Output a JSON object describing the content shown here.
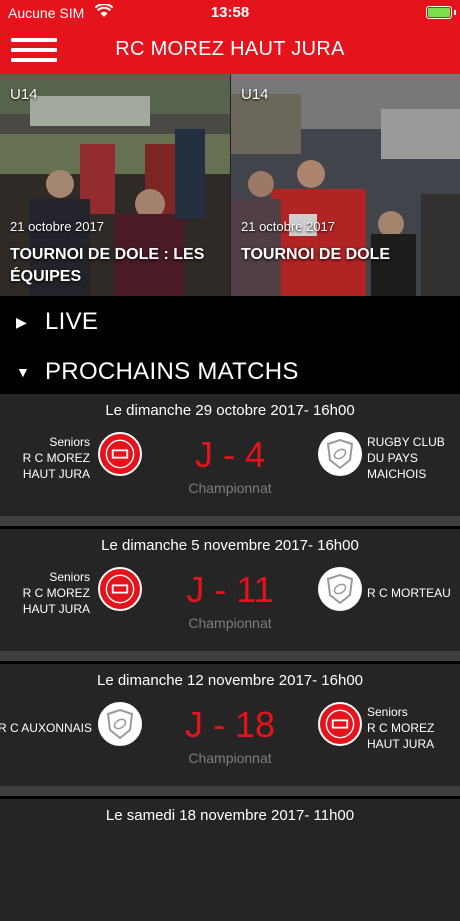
{
  "status_bar": {
    "carrier": "Aucune SIM",
    "time": "13:58"
  },
  "header": {
    "title": "RC MOREZ HAUT JURA"
  },
  "news": [
    {
      "category": "U14",
      "date": "21 octobre 2017",
      "title": "TOURNOI DE DOLE : LES ÉQUIPES"
    },
    {
      "category": "U14",
      "date": "21 octobre 2017",
      "title": "TOURNOI DE DOLE"
    }
  ],
  "sections": {
    "live": "LIVE",
    "upcoming": "PROCHAINS MATCHS"
  },
  "matches": [
    {
      "date": "Le dimanche 29 octobre 2017- 16h00",
      "home": "Seniors\nR C MOREZ\nHAUT JURA",
      "away": "RUGBY CLUB\nDU PAYS\nMAICHOIS",
      "countdown": "J - 4",
      "competition": "Championnat"
    },
    {
      "date": "Le dimanche 5 novembre 2017- 16h00",
      "home": "Seniors\nR C MOREZ\nHAUT JURA",
      "away": "R C MORTEAU",
      "countdown": "J - 11",
      "competition": "Championnat"
    },
    {
      "date": "Le dimanche 12 novembre 2017- 16h00",
      "home": "R C AUXONNAIS",
      "away": "Seniors\nR C MOREZ\nHAUT JURA",
      "countdown": "J - 18",
      "competition": "Championnat"
    },
    {
      "date": "Le samedi 18 novembre 2017- 11h00"
    }
  ],
  "colors": {
    "accent": "#e5131b",
    "card_bg": "#252525",
    "muted": "#7d7d7d"
  }
}
